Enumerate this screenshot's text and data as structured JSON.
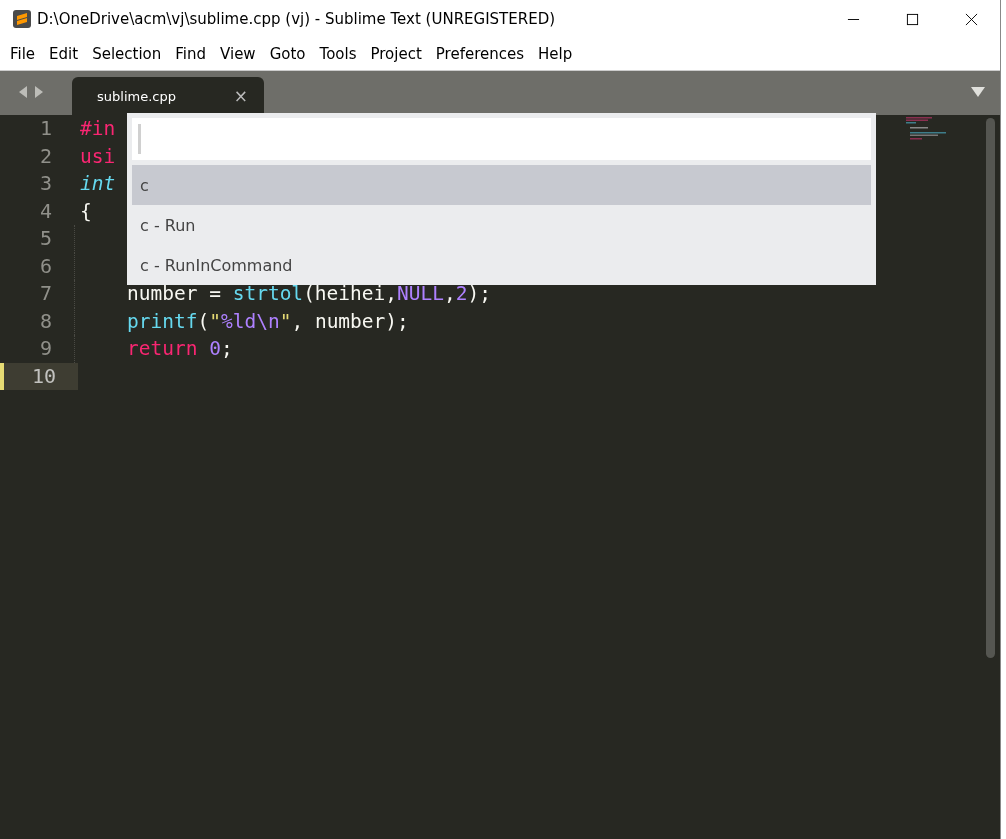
{
  "window": {
    "title": "D:\\OneDrive\\acm\\vj\\sublime.cpp (vj) - Sublime Text (UNREGISTERED)"
  },
  "menu": [
    "File",
    "Edit",
    "Selection",
    "Find",
    "View",
    "Goto",
    "Tools",
    "Project",
    "Preferences",
    "Help"
  ],
  "tabs": [
    {
      "label": "sublime.cpp",
      "selected": true,
      "close": "×"
    }
  ],
  "editor": {
    "lines": [
      {
        "number": "1",
        "current": false,
        "indent": false,
        "tokens": [
          {
            "kind": "keyword",
            "text": "#in"
          }
        ]
      },
      {
        "number": "2",
        "current": false,
        "indent": false,
        "tokens": [
          {
            "kind": "keyword",
            "text": "usi"
          }
        ]
      },
      {
        "number": "3",
        "current": false,
        "indent": false,
        "tokens": [
          {
            "kind": "type",
            "text": "int"
          }
        ]
      },
      {
        "number": "4",
        "current": false,
        "indent": false,
        "tokens": [
          {
            "kind": "plain",
            "text": "{"
          }
        ]
      },
      {
        "number": "5",
        "current": false,
        "indent": true
      },
      {
        "number": "6",
        "current": false,
        "indent": true
      },
      {
        "number": "7",
        "current": false,
        "indent": true,
        "tokens": [
          {
            "kind": "plain",
            "text": "number = "
          },
          {
            "kind": "func",
            "text": "strtol"
          },
          {
            "kind": "plain",
            "text": "(heihei,"
          },
          {
            "kind": "number",
            "text": "NULL"
          },
          {
            "kind": "plain",
            "text": ","
          },
          {
            "kind": "number",
            "text": "2"
          },
          {
            "kind": "plain",
            "text": ");"
          }
        ]
      },
      {
        "number": "8",
        "current": false,
        "indent": true,
        "tokens": [
          {
            "kind": "func",
            "text": "printf"
          },
          {
            "kind": "plain",
            "text": "("
          },
          {
            "kind": "string",
            "text": "\""
          },
          {
            "kind": "number",
            "text": "%ld\\n"
          },
          {
            "kind": "string",
            "text": "\""
          },
          {
            "kind": "plain",
            "text": ", number);"
          }
        ]
      },
      {
        "number": "9",
        "current": false,
        "indent": true,
        "tokens": [
          {
            "kind": "keyword",
            "text": "return"
          },
          {
            "kind": "number",
            "text": "0",
            "gap_before": true
          },
          {
            "kind": "plain",
            "text": ";"
          }
        ]
      },
      {
        "number": "10",
        "current": true,
        "indent": false
      }
    ]
  },
  "palette": {
    "items": [
      {
        "label": "c",
        "selected": true
      },
      {
        "label": "c - Run",
        "selected": false
      },
      {
        "label": "c - RunInCommand",
        "selected": false
      }
    ]
  }
}
